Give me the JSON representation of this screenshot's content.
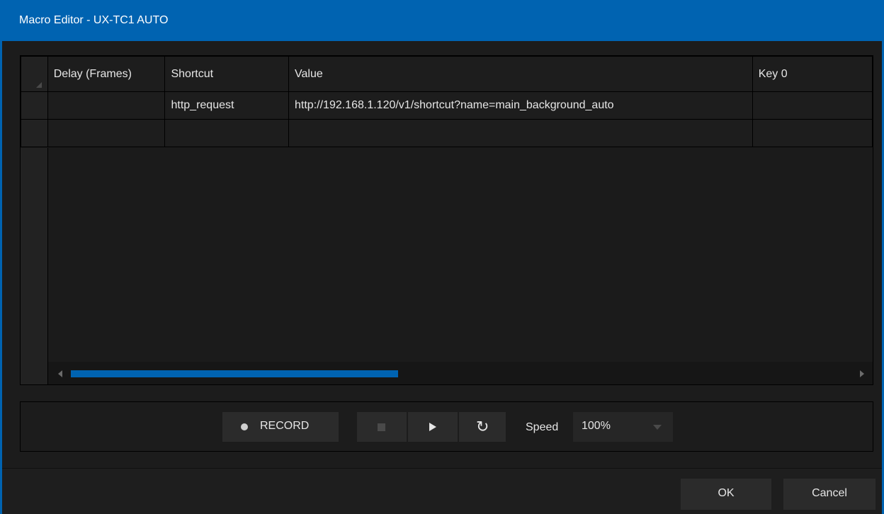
{
  "window": {
    "title": "Macro Editor - UX-TC1 AUTO"
  },
  "grid": {
    "columns": [
      "Delay (Frames)",
      "Shortcut",
      "Value",
      "Key 0"
    ],
    "rows": [
      {
        "delay": "",
        "shortcut": "http_request",
        "value": "http://192.168.1.120/v1/shortcut?name=main_background_auto",
        "key0": ""
      },
      {
        "delay": "",
        "shortcut": "",
        "value": "",
        "key0": ""
      }
    ]
  },
  "controls": {
    "record_label": "RECORD",
    "speed_label": "Speed",
    "speed_value": "100%"
  },
  "footer": {
    "ok_label": "OK",
    "cancel_label": "Cancel"
  },
  "colors": {
    "accent": "#0063b1",
    "background": "#1c1c1c",
    "button": "#2b2b2b"
  }
}
